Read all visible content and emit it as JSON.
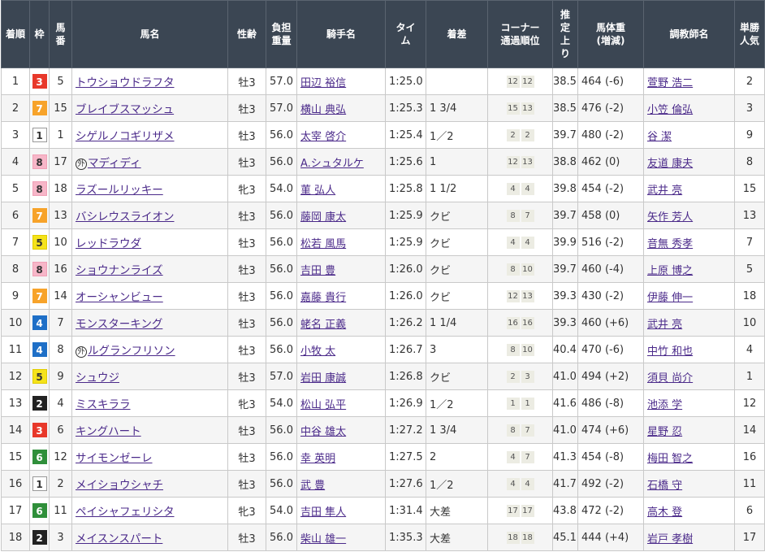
{
  "headers": [
    "着順",
    "枠",
    "馬番",
    "馬名",
    "性齢",
    "負担重量",
    "騎手名",
    "タイム",
    "着差",
    "コーナー通過順位",
    "推定上り",
    "馬体重(増減)",
    "調教師名",
    "単勝人気"
  ],
  "header_lines": {
    "chakujun": [
      "着順"
    ],
    "waku": [
      "枠"
    ],
    "umaban": [
      "馬",
      "番"
    ],
    "name": [
      "馬名"
    ],
    "seirei": [
      "性齢"
    ],
    "futan": [
      "負担",
      "重量"
    ],
    "jockey": [
      "騎手名"
    ],
    "time": [
      "タイ",
      "ム"
    ],
    "chakusa": [
      "着差"
    ],
    "corner": [
      "コーナー",
      "通過順位"
    ],
    "agari": [
      "推",
      "定",
      "上",
      "り"
    ],
    "bataiju": [
      "馬体重",
      "(増減)"
    ],
    "trainer": [
      "調教師名"
    ],
    "ninki": [
      "単勝",
      "人気"
    ]
  },
  "waku_colors": {
    "1": {
      "bg": "#ffffff",
      "fg": "#333333",
      "border": "#999999"
    },
    "2": {
      "bg": "#222222",
      "fg": "#ffffff",
      "border": "#222222"
    },
    "3": {
      "bg": "#e8382a",
      "fg": "#ffffff",
      "border": "#e8382a"
    },
    "4": {
      "bg": "#1e6fc7",
      "fg": "#ffffff",
      "border": "#1e6fc7"
    },
    "5": {
      "bg": "#f5e31a",
      "fg": "#333333",
      "border": "#e0cc00"
    },
    "6": {
      "bg": "#2f8f3a",
      "fg": "#ffffff",
      "border": "#2f8f3a"
    },
    "7": {
      "bg": "#f7a32a",
      "fg": "#ffffff",
      "border": "#f7a32a"
    },
    "8": {
      "bg": "#f7b6c8",
      "fg": "#333333",
      "border": "#f0a0b6"
    }
  },
  "rows": [
    {
      "chakujun": "1",
      "waku": "3",
      "umaban": "5",
      "name": "トウショウドラフタ",
      "foreign": false,
      "seirei": "牡3",
      "futan": "57.0",
      "jockey": "田辺 裕信",
      "time": "1:25.0",
      "chakusa": "",
      "corner": [
        "12",
        "12"
      ],
      "agari": "38.5",
      "bataiju": "464 (-6)",
      "trainer": "萱野 浩二",
      "ninki": "2"
    },
    {
      "chakujun": "2",
      "waku": "7",
      "umaban": "15",
      "name": "ブレイブスマッシュ",
      "foreign": false,
      "seirei": "牡3",
      "futan": "57.0",
      "jockey": "横山 典弘",
      "time": "1:25.3",
      "chakusa": "1 3/4",
      "corner": [
        "15",
        "13"
      ],
      "agari": "38.5",
      "bataiju": "476 (-2)",
      "trainer": "小笠 倫弘",
      "ninki": "3"
    },
    {
      "chakujun": "3",
      "waku": "1",
      "umaban": "1",
      "name": "シゲルノコギリザメ",
      "foreign": false,
      "seirei": "牡3",
      "futan": "56.0",
      "jockey": "太宰 啓介",
      "time": "1:25.4",
      "chakusa": "1／2",
      "corner": [
        "2",
        "2"
      ],
      "agari": "39.7",
      "bataiju": "480 (-2)",
      "trainer": "谷 潔",
      "ninki": "9"
    },
    {
      "chakujun": "4",
      "waku": "8",
      "umaban": "17",
      "name": "マディディ",
      "foreign": true,
      "foreign_mark": "外",
      "seirei": "牡3",
      "futan": "56.0",
      "jockey": "A.シュタルケ",
      "time": "1:25.6",
      "chakusa": "1",
      "corner": [
        "12",
        "13"
      ],
      "agari": "38.8",
      "bataiju": "462 (0)",
      "trainer": "友道 康夫",
      "ninki": "8"
    },
    {
      "chakujun": "5",
      "waku": "8",
      "umaban": "18",
      "name": "ラズールリッキー",
      "foreign": false,
      "seirei": "牝3",
      "futan": "54.0",
      "jockey": "菫 弘人",
      "time": "1:25.8",
      "chakusa": "1 1/2",
      "corner": [
        "4",
        "4"
      ],
      "agari": "39.8",
      "bataiju": "454 (-2)",
      "trainer": "武井 亮",
      "ninki": "15"
    },
    {
      "chakujun": "6",
      "waku": "7",
      "umaban": "13",
      "name": "バシレウスライオン",
      "foreign": false,
      "seirei": "牡3",
      "futan": "56.0",
      "jockey": "藤岡 康太",
      "time": "1:25.9",
      "chakusa": "クビ",
      "corner": [
        "8",
        "7"
      ],
      "agari": "39.7",
      "bataiju": "458 (0)",
      "trainer": "矢作 芳人",
      "ninki": "13"
    },
    {
      "chakujun": "7",
      "waku": "5",
      "umaban": "10",
      "name": "レッドラウダ",
      "foreign": false,
      "seirei": "牡3",
      "futan": "56.0",
      "jockey": "松若 風馬",
      "time": "1:25.9",
      "chakusa": "クビ",
      "corner": [
        "4",
        "4"
      ],
      "agari": "39.9",
      "bataiju": "516 (-2)",
      "trainer": "音無 秀孝",
      "ninki": "7"
    },
    {
      "chakujun": "8",
      "waku": "8",
      "umaban": "16",
      "name": "ショウナンライズ",
      "foreign": false,
      "seirei": "牡3",
      "futan": "56.0",
      "jockey": "吉田 豊",
      "time": "1:26.0",
      "chakusa": "クビ",
      "corner": [
        "8",
        "10"
      ],
      "agari": "39.7",
      "bataiju": "460 (-4)",
      "trainer": "上原 博之",
      "ninki": "5"
    },
    {
      "chakujun": "9",
      "waku": "7",
      "umaban": "14",
      "name": "オーシャンビュー",
      "foreign": false,
      "seirei": "牡3",
      "futan": "56.0",
      "jockey": "嘉藤 貴行",
      "time": "1:26.0",
      "chakusa": "クビ",
      "corner": [
        "12",
        "13"
      ],
      "agari": "39.3",
      "bataiju": "430 (-2)",
      "trainer": "伊藤 伸一",
      "ninki": "18"
    },
    {
      "chakujun": "10",
      "waku": "4",
      "umaban": "7",
      "name": "モンスターキング",
      "foreign": false,
      "seirei": "牡3",
      "futan": "56.0",
      "jockey": "蛯名 正義",
      "time": "1:26.2",
      "chakusa": "1 1/4",
      "corner": [
        "16",
        "16"
      ],
      "agari": "39.3",
      "bataiju": "460 (+6)",
      "trainer": "武井 亮",
      "ninki": "10"
    },
    {
      "chakujun": "11",
      "waku": "4",
      "umaban": "8",
      "name": "ルグランフリソン",
      "foreign": true,
      "foreign_mark": "外",
      "seirei": "牡3",
      "futan": "56.0",
      "jockey": "小牧 太",
      "time": "1:26.7",
      "chakusa": "3",
      "corner": [
        "8",
        "10"
      ],
      "agari": "40.4",
      "bataiju": "470 (-6)",
      "trainer": "中竹 和也",
      "ninki": "4"
    },
    {
      "chakujun": "12",
      "waku": "5",
      "umaban": "9",
      "name": "シュウジ",
      "foreign": false,
      "seirei": "牡3",
      "futan": "57.0",
      "jockey": "岩田 康誠",
      "time": "1:26.8",
      "chakusa": "クビ",
      "corner": [
        "2",
        "3"
      ],
      "agari": "41.0",
      "bataiju": "494 (+2)",
      "trainer": "須貝 尚介",
      "ninki": "1"
    },
    {
      "chakujun": "13",
      "waku": "2",
      "umaban": "4",
      "name": "ミスキララ",
      "foreign": false,
      "seirei": "牝3",
      "futan": "54.0",
      "jockey": "松山 弘平",
      "time": "1:26.9",
      "chakusa": "1／2",
      "corner": [
        "1",
        "1"
      ],
      "agari": "41.6",
      "bataiju": "486 (-8)",
      "trainer": "池添 学",
      "ninki": "12"
    },
    {
      "chakujun": "14",
      "waku": "3",
      "umaban": "6",
      "name": "キングハート",
      "foreign": false,
      "seirei": "牡3",
      "futan": "56.0",
      "jockey": "中谷 雄太",
      "time": "1:27.2",
      "chakusa": "1 3/4",
      "corner": [
        "8",
        "7"
      ],
      "agari": "41.0",
      "bataiju": "474 (+6)",
      "trainer": "星野 忍",
      "ninki": "14"
    },
    {
      "chakujun": "15",
      "waku": "6",
      "umaban": "12",
      "name": "サイモンゼーレ",
      "foreign": false,
      "seirei": "牡3",
      "futan": "56.0",
      "jockey": "幸 英明",
      "time": "1:27.5",
      "chakusa": "2",
      "corner": [
        "4",
        "7"
      ],
      "agari": "41.3",
      "bataiju": "454 (-8)",
      "trainer": "梅田 智之",
      "ninki": "16"
    },
    {
      "chakujun": "16",
      "waku": "1",
      "umaban": "2",
      "name": "メイショウシャチ",
      "foreign": false,
      "seirei": "牡3",
      "futan": "56.0",
      "jockey": "武 豊",
      "time": "1:27.6",
      "chakusa": "1／2",
      "corner": [
        "4",
        "4"
      ],
      "agari": "41.7",
      "bataiju": "492 (-2)",
      "trainer": "石橋 守",
      "ninki": "11"
    },
    {
      "chakujun": "17",
      "waku": "6",
      "umaban": "11",
      "name": "ペイシャフェリシタ",
      "foreign": false,
      "seirei": "牝3",
      "futan": "54.0",
      "jockey": "吉田 隼人",
      "time": "1:31.4",
      "chakusa": "大差",
      "corner": [
        "17",
        "17"
      ],
      "agari": "43.8",
      "bataiju": "472 (-2)",
      "trainer": "高木 登",
      "ninki": "6"
    },
    {
      "chakujun": "18",
      "waku": "2",
      "umaban": "3",
      "name": "メイスンスパート",
      "foreign": false,
      "seirei": "牡3",
      "futan": "56.0",
      "jockey": "柴山 雄一",
      "time": "1:35.3",
      "chakusa": "大差",
      "corner": [
        "18",
        "18"
      ],
      "agari": "45.1",
      "bataiju": "444 (+4)",
      "trainer": "岩戸 孝樹",
      "ninki": "17"
    }
  ]
}
